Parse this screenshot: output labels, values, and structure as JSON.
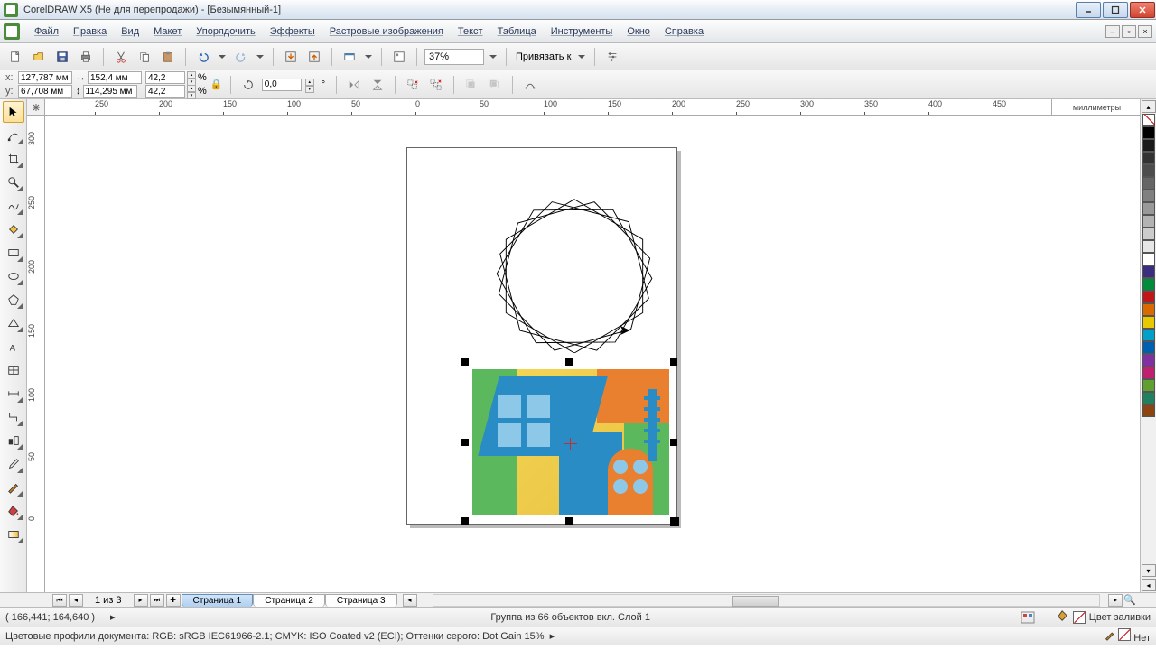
{
  "titlebar": {
    "text": "CorelDRAW X5 (Не для перепродажи) - [Безымянный-1]"
  },
  "menu": {
    "file": "Файл",
    "edit": "Правка",
    "view": "Вид",
    "layout": "Макет",
    "arrange": "Упорядочить",
    "effects": "Эффекты",
    "bitmaps": "Растровые изображения",
    "text": "Текст",
    "table": "Таблица",
    "tools": "Инструменты",
    "window": "Окно",
    "help": "Справка"
  },
  "toolbar": {
    "zoom": "37%",
    "snap_label": "Привязать к"
  },
  "props": {
    "x_label": "x:",
    "x": "127,787 мм",
    "y_label": "y:",
    "y": "67,708 мм",
    "w": "152,4 мм",
    "h": "114,295 мм",
    "sx": "42,2",
    "sy": "42,2",
    "pct": "%",
    "rot": "0,0",
    "deg": "°"
  },
  "ruler": {
    "units": "миллиметры",
    "h": [
      "250",
      "200",
      "150",
      "100",
      "50",
      "0",
      "50",
      "100",
      "150",
      "200",
      "250",
      "300",
      "350",
      "400",
      "450"
    ],
    "v": [
      "300",
      "250",
      "200",
      "150",
      "100",
      "50",
      "0"
    ]
  },
  "pagebar": {
    "counter": "1 из 3",
    "tabs": [
      "Страница 1",
      "Страница 2",
      "Страница 3"
    ]
  },
  "status": {
    "coords": "( 166,441; 164,640 )",
    "selection": "Группа из 66 объектов вкл. Слой 1",
    "fill_label": "Цвет заливки",
    "outline_label": "Нет",
    "profiles": "Цветовые профили документа: RGB: sRGB IEC61966-2.1; CMYK: ISO Coated v2 (ECI); Оттенки серого: Dot Gain 15%"
  },
  "palette": [
    "#000000",
    "#1a1a1a",
    "#333333",
    "#4d4d4d",
    "#666666",
    "#808080",
    "#999999",
    "#b3b3b3",
    "#cccccc",
    "#e6e6e6",
    "#ffffff",
    "#3b2e7e",
    "#008c3a",
    "#c01818",
    "#d86a00",
    "#e8c800",
    "#00a0c8",
    "#0060b0",
    "#8030a0",
    "#c02070",
    "#60a030",
    "#208060",
    "#8b4513"
  ]
}
